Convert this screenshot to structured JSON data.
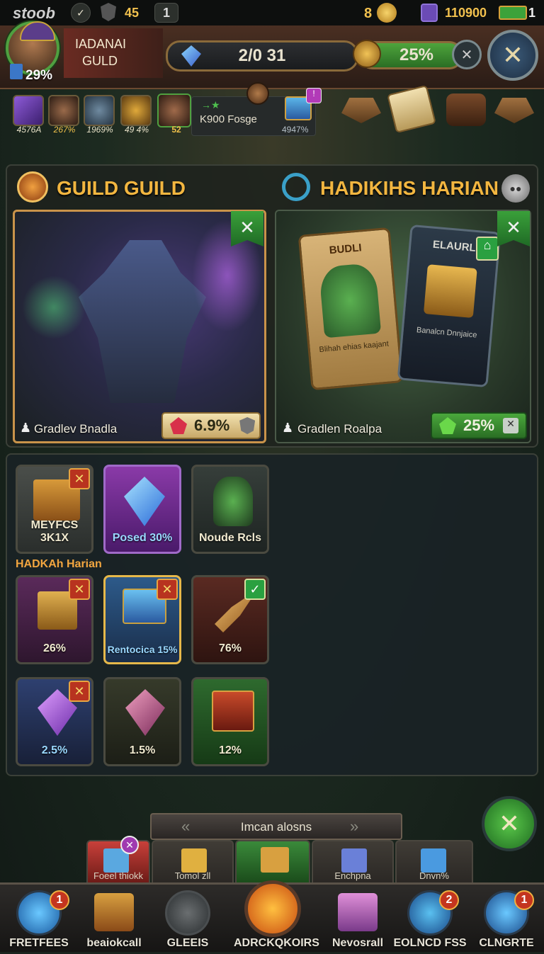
{
  "status": {
    "app": "stoob",
    "count": "45",
    "level": "1",
    "coins_prefix": "8",
    "gems": "110900",
    "energy": "1"
  },
  "header": {
    "guild_line1": "IADANAI",
    "guild_line2": "GULD",
    "avatar_pct": "29%",
    "progress": "2/0 31",
    "bonus": "25%"
  },
  "resources": [
    {
      "label": "4576A",
      "icon": "purple-gem-icon"
    },
    {
      "label": "267%",
      "icon": "hero-portrait-icon"
    },
    {
      "label": "1969%",
      "icon": "shield-icon"
    },
    {
      "label": "49 4%",
      "icon": "gold-crest-icon"
    },
    {
      "label": "52",
      "icon": "hero-green-icon"
    }
  ],
  "forge": {
    "name": "K900 Fosge",
    "sub": "4947%"
  },
  "sections": {
    "left_title": "GUILD GUILD",
    "right_title": "HADIKIHS HARIAN"
  },
  "cards": {
    "left": {
      "caption": "Gradlev Bnadla",
      "pct": "6.9%"
    },
    "right": {
      "caption": "Gradlen Roalpa",
      "pct": "25%",
      "card1_title": "BUDLI",
      "card1_text": "Blihah ehias kaajant",
      "card2_title": "ELAURL",
      "card2_text": "Banalcn Dnnjaice"
    }
  },
  "section_label": "HADKAh Harian",
  "tiles": [
    {
      "label": "MEYFCS 3K1X",
      "color": "#3a3f3c"
    },
    {
      "label": "Posed 30%",
      "color": "#6a2f8a"
    },
    {
      "label": "Noude Rcls",
      "color": "#2e3532"
    },
    {
      "label": "26%",
      "color": "#4c2a4c"
    },
    {
      "label": "Rentocica 15%",
      "color": "#2d4a6a"
    },
    {
      "label": "76%",
      "color": "#4a231c"
    },
    {
      "label": "2.5%",
      "color": "#2a3a5a"
    },
    {
      "label": "1.5%",
      "color": "#2d3126"
    },
    {
      "label": "12%",
      "color": "#2c5a2c"
    }
  ],
  "pager": {
    "label": "Imcan alosns"
  },
  "bottom_tabs": [
    "Foeel thiokk",
    "Tomol zll",
    "",
    "Enchpna",
    "Dnvn%"
  ],
  "nav": [
    {
      "label": "FRETFEES",
      "badge": "1"
    },
    {
      "label": "beaiokcall",
      "badge": ""
    },
    {
      "label": "GLEEIS",
      "badge": ""
    },
    {
      "label": "ADRCKQKOIRS",
      "badge": ""
    },
    {
      "label": "Nevosrall",
      "badge": ""
    },
    {
      "label": "EOLNCD FSS",
      "badge": "2"
    },
    {
      "label": "CLNGRTE",
      "badge": "1"
    }
  ]
}
